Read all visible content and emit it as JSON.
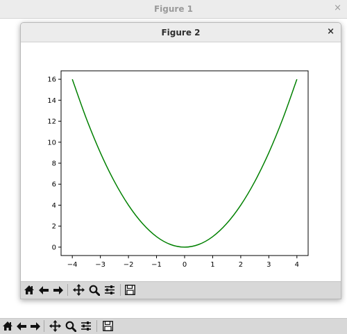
{
  "figure1": {
    "title": "Figure 1",
    "close_glyph": "×",
    "toolbar": [
      "home-icon",
      "back-arrow-icon",
      "forward-arrow-icon",
      "pan-move-icon",
      "zoom-magnifier-icon",
      "configure-subplots-icon",
      "save-disk-icon"
    ]
  },
  "figure2": {
    "title": "Figure 2",
    "close_glyph": "×",
    "toolbar": [
      "home-icon",
      "back-arrow-icon",
      "forward-arrow-icon",
      "pan-move-icon",
      "zoom-magnifier-icon",
      "configure-subplots-icon",
      "save-disk-icon"
    ]
  },
  "colors": {
    "line": "#008000",
    "axes": "#000000"
  },
  "chart_data": {
    "type": "line",
    "function": "y = x^2",
    "title": "",
    "xlabel": "",
    "ylabel": "",
    "xlim": [
      -4.4,
      4.4
    ],
    "ylim": [
      -0.8,
      16.8
    ],
    "x_ticks": [
      -4,
      -3,
      -2,
      -1,
      0,
      1,
      2,
      3,
      4
    ],
    "x_tick_labels": [
      "−4",
      "−3",
      "−2",
      "−1",
      "0",
      "1",
      "2",
      "3",
      "4"
    ],
    "y_ticks": [
      0,
      2,
      4,
      6,
      8,
      10,
      12,
      14,
      16
    ],
    "y_tick_labels": [
      "0",
      "2",
      "4",
      "6",
      "8",
      "10",
      "12",
      "14",
      "16"
    ],
    "grid": false,
    "series": [
      {
        "color": "#008000",
        "x": [
          -4,
          -3.5,
          -3,
          -2.5,
          -2,
          -1.5,
          -1,
          -0.5,
          0,
          0.5,
          1,
          1.5,
          2,
          2.5,
          3,
          3.5,
          4
        ],
        "y": [
          16,
          12.25,
          9,
          6.25,
          4,
          2.25,
          1,
          0.25,
          0,
          0.25,
          1,
          2.25,
          4,
          6.25,
          9,
          12.25,
          16
        ]
      }
    ]
  }
}
